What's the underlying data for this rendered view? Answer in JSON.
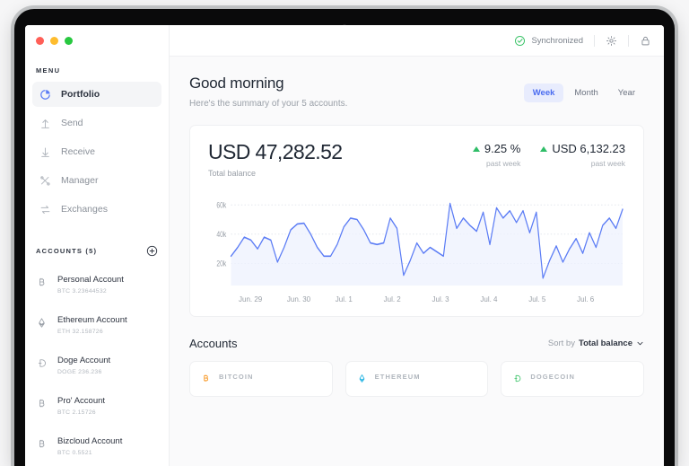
{
  "window": {
    "traffic_lights": [
      "close",
      "minimize",
      "maximize"
    ]
  },
  "sidebar": {
    "menu_label": "MENU",
    "items": [
      {
        "label": "Portfolio",
        "icon": "pie-chart-icon",
        "active": true
      },
      {
        "label": "Send",
        "icon": "arrow-up-icon",
        "active": false
      },
      {
        "label": "Receive",
        "icon": "arrow-down-icon",
        "active": false
      },
      {
        "label": "Manager",
        "icon": "tools-icon",
        "active": false
      },
      {
        "label": "Exchanges",
        "icon": "swap-icon",
        "active": false
      }
    ],
    "accounts_label": "ACCOUNTS (5)",
    "add_icon": "plus-circle-icon",
    "accounts": [
      {
        "name": "Personal Account",
        "balance": "BTC 3.23644532",
        "icon": "bitcoin-icon"
      },
      {
        "name": "Ethereum Account",
        "balance": "ETH 32.158726",
        "icon": "ethereum-icon"
      },
      {
        "name": "Doge Account",
        "balance": "DOGE 236.236",
        "icon": "dogecoin-icon"
      },
      {
        "name": "Pro' Account",
        "balance": "BTC 2.15726",
        "icon": "bitcoin-icon"
      },
      {
        "name": "Bizcloud Account",
        "balance": "BTC 0.5521",
        "icon": "bitcoin-icon"
      }
    ]
  },
  "topbar": {
    "sync_status": "Synchronized",
    "sync_icon": "check-circle-icon",
    "settings_icon": "gear-icon",
    "lock_icon": "lock-icon",
    "sync_color": "#3dc46a"
  },
  "header": {
    "greeting": "Good morning",
    "subtitle": "Here's the summary of your 5 accounts.",
    "ranges": [
      {
        "label": "Week",
        "active": true
      },
      {
        "label": "Month",
        "active": false
      },
      {
        "label": "Year",
        "active": false
      }
    ],
    "active_range_color": "#4a6cf0"
  },
  "balance_card": {
    "total": "USD 47,282.52",
    "total_label": "Total balance",
    "stats": [
      {
        "value": "9.25 %",
        "period": "past week",
        "direction": "up"
      },
      {
        "value": "USD 6,132.23",
        "period": "past week",
        "direction": "up"
      }
    ],
    "up_color": "#2ebd67"
  },
  "accounts_section": {
    "title": "Accounts",
    "sort_prefix": "Sort by",
    "sort_value": "Total balance",
    "chevron_icon": "chevron-down-icon",
    "cards": [
      {
        "name": "BITCOIN",
        "icon": "bitcoin-icon",
        "color": "#f7931a"
      },
      {
        "name": "ETHEREUM",
        "icon": "ethereum-icon",
        "color": "#2ab6e4"
      },
      {
        "name": "DOGECOIN",
        "icon": "dogecoin-icon",
        "color": "#3dc46a"
      }
    ]
  },
  "chart_data": {
    "type": "area",
    "title": "",
    "xlabel": "",
    "ylabel": "",
    "line_color": "#5b7cf5",
    "fill_color": "#eef2fe",
    "grid": true,
    "ylim": [
      5000,
      65000
    ],
    "ytick_labels": [
      "20k",
      "40k",
      "60k"
    ],
    "ytick_values": [
      20000,
      40000,
      60000
    ],
    "categories": [
      "Jun. 29",
      "Jun. 30",
      "Jul. 1",
      "Jul. 2",
      "Jul. 3",
      "Jul. 4",
      "Jul. 5",
      "Jul. 6"
    ],
    "values": [
      25000,
      31000,
      38000,
      36000,
      30000,
      38000,
      36000,
      21000,
      31000,
      43000,
      47000,
      47500,
      40000,
      31000,
      25000,
      25000,
      33000,
      45000,
      51000,
      50000,
      43000,
      34000,
      33000,
      34000,
      51000,
      44000,
      12000,
      22000,
      34000,
      27000,
      31000,
      28000,
      25000,
      61000,
      44000,
      51000,
      46000,
      42000,
      55000,
      33000,
      58000,
      51000,
      56000,
      48000,
      56000,
      41000,
      55000,
      10000,
      22000,
      32000,
      21000,
      30000,
      37000,
      27000,
      41000,
      31000,
      46000,
      51000,
      44000,
      57000
    ]
  }
}
